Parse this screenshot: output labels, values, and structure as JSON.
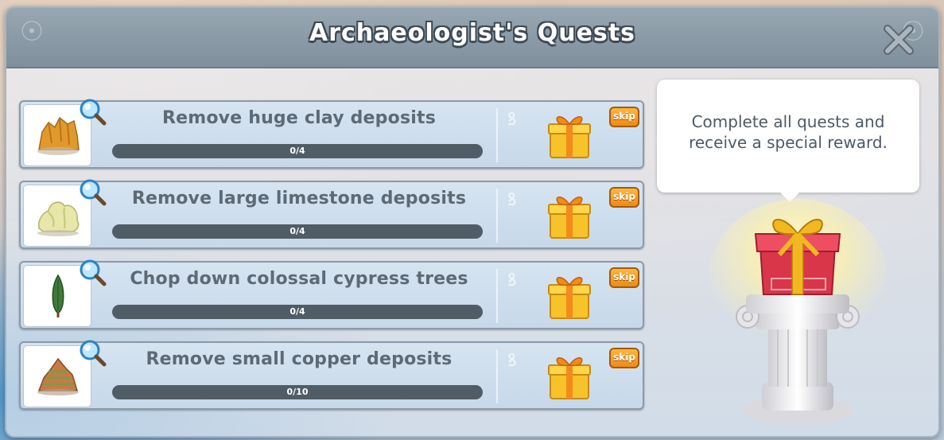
{
  "window": {
    "title": "Archaeologist's Quests"
  },
  "quests": [
    {
      "icon": "clay-deposit-icon",
      "title": "Remove huge clay deposits",
      "progress_text": "0/4",
      "progress": 0,
      "skip_label": "skip"
    },
    {
      "icon": "limestone-deposit-icon",
      "title": "Remove large limestone deposits",
      "progress_text": "0/4",
      "progress": 0,
      "skip_label": "skip"
    },
    {
      "icon": "cypress-tree-icon",
      "title": "Chop down colossal cypress trees",
      "progress_text": "0/4",
      "progress": 0,
      "skip_label": "skip"
    },
    {
      "icon": "copper-deposit-icon",
      "title": "Remove small copper deposits",
      "progress_text": "0/10",
      "progress": 0,
      "skip_label": "skip"
    }
  ],
  "reward_panel": {
    "message": "Complete all quests and receive a special reward."
  },
  "colors": {
    "title_bar": "#8a99a5",
    "skip_button": "#f59a1e",
    "progress_track": "#515d66",
    "gift_gold": "#f2b81f",
    "grand_gift_red": "#d9364a"
  }
}
